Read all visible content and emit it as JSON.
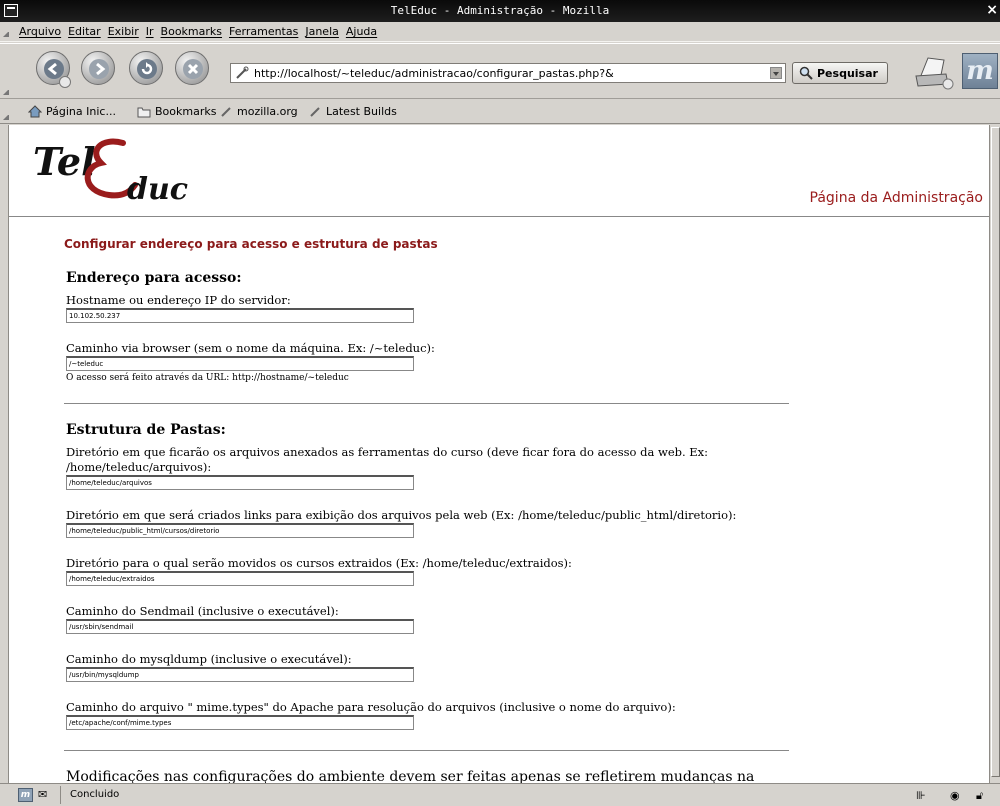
{
  "window": {
    "title": "TelEduc - Administração - Mozilla"
  },
  "menu": [
    "Arquivo",
    "Editar",
    "Exibir",
    "Ir",
    "Bookmarks",
    "Ferramentas",
    "Janela",
    "Ajuda"
  ],
  "toolbar": {
    "url": "http://localhost/~teleduc/administracao/configurar_pastas.php?&",
    "search_label": "Pesquisar"
  },
  "bookmarks": [
    "Página Inic...",
    "Bookmarks",
    "mozilla.org",
    "Latest Builds"
  ],
  "page": {
    "logo_text_1": "Tel",
    "logo_text_2": "duc",
    "admin_title": "Página da Administração",
    "section_title": "Configurar endereço para acesso e estrutura de pastas",
    "access": {
      "heading": "Endereço para acesso:",
      "host_label": "Hostname ou endereço IP do servidor:",
      "host_value": "10.102.50.237",
      "path_label": "Caminho via browser (sem o nome da máquina. Ex: /~teleduc):",
      "path_value": "/~teleduc",
      "path_hint": "O acesso será feito através da URL: http://hostname/~teleduc"
    },
    "folders": {
      "heading": "Estrutura de Pastas:",
      "fields": [
        {
          "label": "Diretório em que ficarão os arquivos anexados as ferramentas do curso (deve ficar fora do acesso da web. Ex: /home/teleduc/arquivos):",
          "value": "/home/teleduc/arquivos"
        },
        {
          "label": "Diretório em que será criados links para exibição dos arquivos pela web (Ex: /home/teleduc/public_html/diretorio):",
          "value": "/home/teleduc/public_html/cursos/diretorio"
        },
        {
          "label": "Diretório para o qual serão movidos os cursos extraidos (Ex: /home/teleduc/extraidos):",
          "value": "/home/teleduc/extraidos"
        },
        {
          "label": "Caminho do Sendmail (inclusive o executável):",
          "value": "/usr/sbin/sendmail"
        },
        {
          "label": "Caminho do mysqldump (inclusive o executável):",
          "value": "/usr/bin/mysqldump"
        },
        {
          "label": "Caminho do arquivo \" mime.types\" do Apache para resolução do arquivos (inclusive o nome do arquivo):",
          "value": "/etc/apache/conf/mime.types"
        }
      ]
    },
    "bottom_text": "Modificações nas configurações do ambiente devem ser feitas apenas se refletirem mudanças na"
  },
  "status": {
    "text": "Concluido"
  },
  "colors": {
    "accent": "#8b1a1a",
    "chrome": "#d6d3ce"
  }
}
